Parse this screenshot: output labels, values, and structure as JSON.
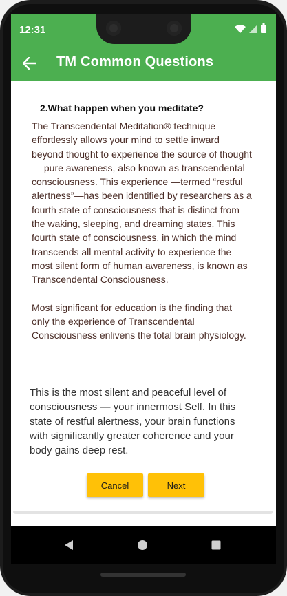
{
  "status_bar": {
    "time": "12:31",
    "icons": [
      "wifi-icon",
      "signal-icon",
      "battery-icon"
    ]
  },
  "app_bar": {
    "title": "TM Common Questions",
    "back_icon": "arrow-back-icon"
  },
  "question": {
    "title": "2.What happen when you meditate?",
    "paragraphs": [
      "The Transcendental Meditation® technique effortlessly allows your mind to settle inward beyond thought to experience the source of thought — pure awareness, also known as transcendental consciousness. This experience —termed “restful alertness”—has been identified by researchers as a fourth state of consciousness that is distinct from the waking, sleeping, and dreaming states. This fourth state of consciousness, in which the mind transcends all mental activity to experience the most silent form of human awareness, is known as Transcendental Consciousness.",
      "Most significant for education is the finding that only the experience of Transcendental Consciousness enlivens the total brain physiology."
    ],
    "extra": "This is the most silent and peaceful level of consciousness — your innermost Self. In this state of restful alertness, your brain functions with significantly greater coherence and your body gains deep rest."
  },
  "buttons": {
    "cancel": "Cancel",
    "next": "Next"
  },
  "nav": {
    "back": "nav-back-icon",
    "home": "nav-home-icon",
    "recent": "nav-recent-icon"
  },
  "colors": {
    "app_bar": "#4caf50",
    "button": "#ffc107",
    "answer_text": "#4a2c26"
  }
}
